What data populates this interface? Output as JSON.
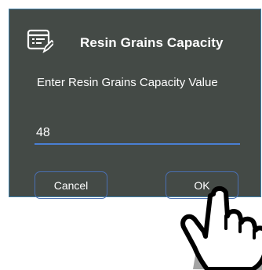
{
  "dialog": {
    "title": "Resin Grains Capacity",
    "prompt": "Enter Resin Grains Capacity Value",
    "icon": "edit-list-icon",
    "input": {
      "value": "48"
    },
    "cancel_label": "Cancel",
    "ok_label": "OK"
  },
  "overlay": {
    "icon": "pointing-hand-cursor-icon"
  },
  "colors": {
    "dialog_bg": "#444a46",
    "accent_border": "#4a6fb2",
    "input_underline": "#4a7fd4",
    "text": "#ffffff"
  }
}
